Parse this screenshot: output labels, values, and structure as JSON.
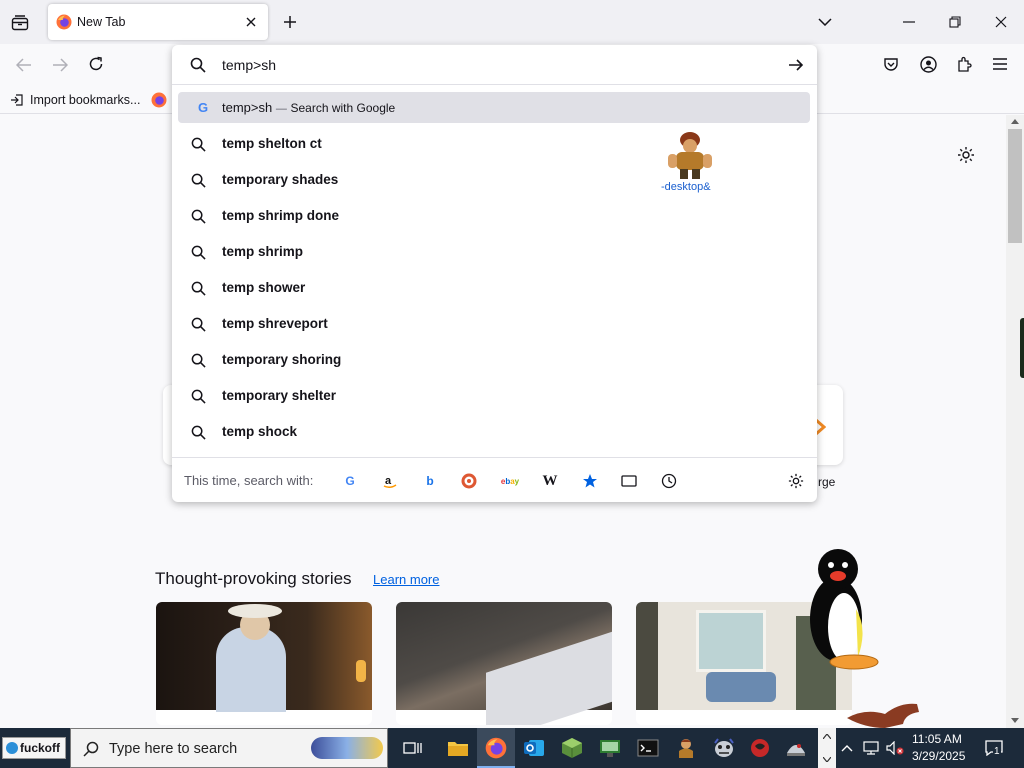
{
  "tab": {
    "title": "New Tab"
  },
  "toolbar": {
    "bookmarks_import_label": "Import bookmarks..."
  },
  "urlbar": {
    "query": "temp>sh"
  },
  "active_suggestion": {
    "text": "temp>sh",
    "separator": "—",
    "action": "Search with Google"
  },
  "suggestions": [
    "temp shelton ct",
    "temporary shades",
    "temp shrimp done",
    "temp shrimp",
    "temp shower",
    "temp shreveport",
    "temporary shoring",
    "temporary shelter",
    "temp shock"
  ],
  "one_off": {
    "label": "This time, search with:",
    "engines": [
      "Google",
      "Amazon",
      "Bing",
      "DuckDuckGo",
      "eBay",
      "Wikipedia",
      "Bookmarks",
      "Tabs",
      "History"
    ]
  },
  "desktop_widget": {
    "label": "-desktop&"
  },
  "partial_text": {
    "shortcut_partial": "rge"
  },
  "stories": {
    "heading": "Thought-provoking stories",
    "learn_more": "Learn more"
  },
  "taskbar": {
    "start_label": "fuckoff",
    "search_placeholder": "Type here to search",
    "time": "11:05 AM",
    "date": "3/29/2025",
    "notification_count": "1"
  }
}
